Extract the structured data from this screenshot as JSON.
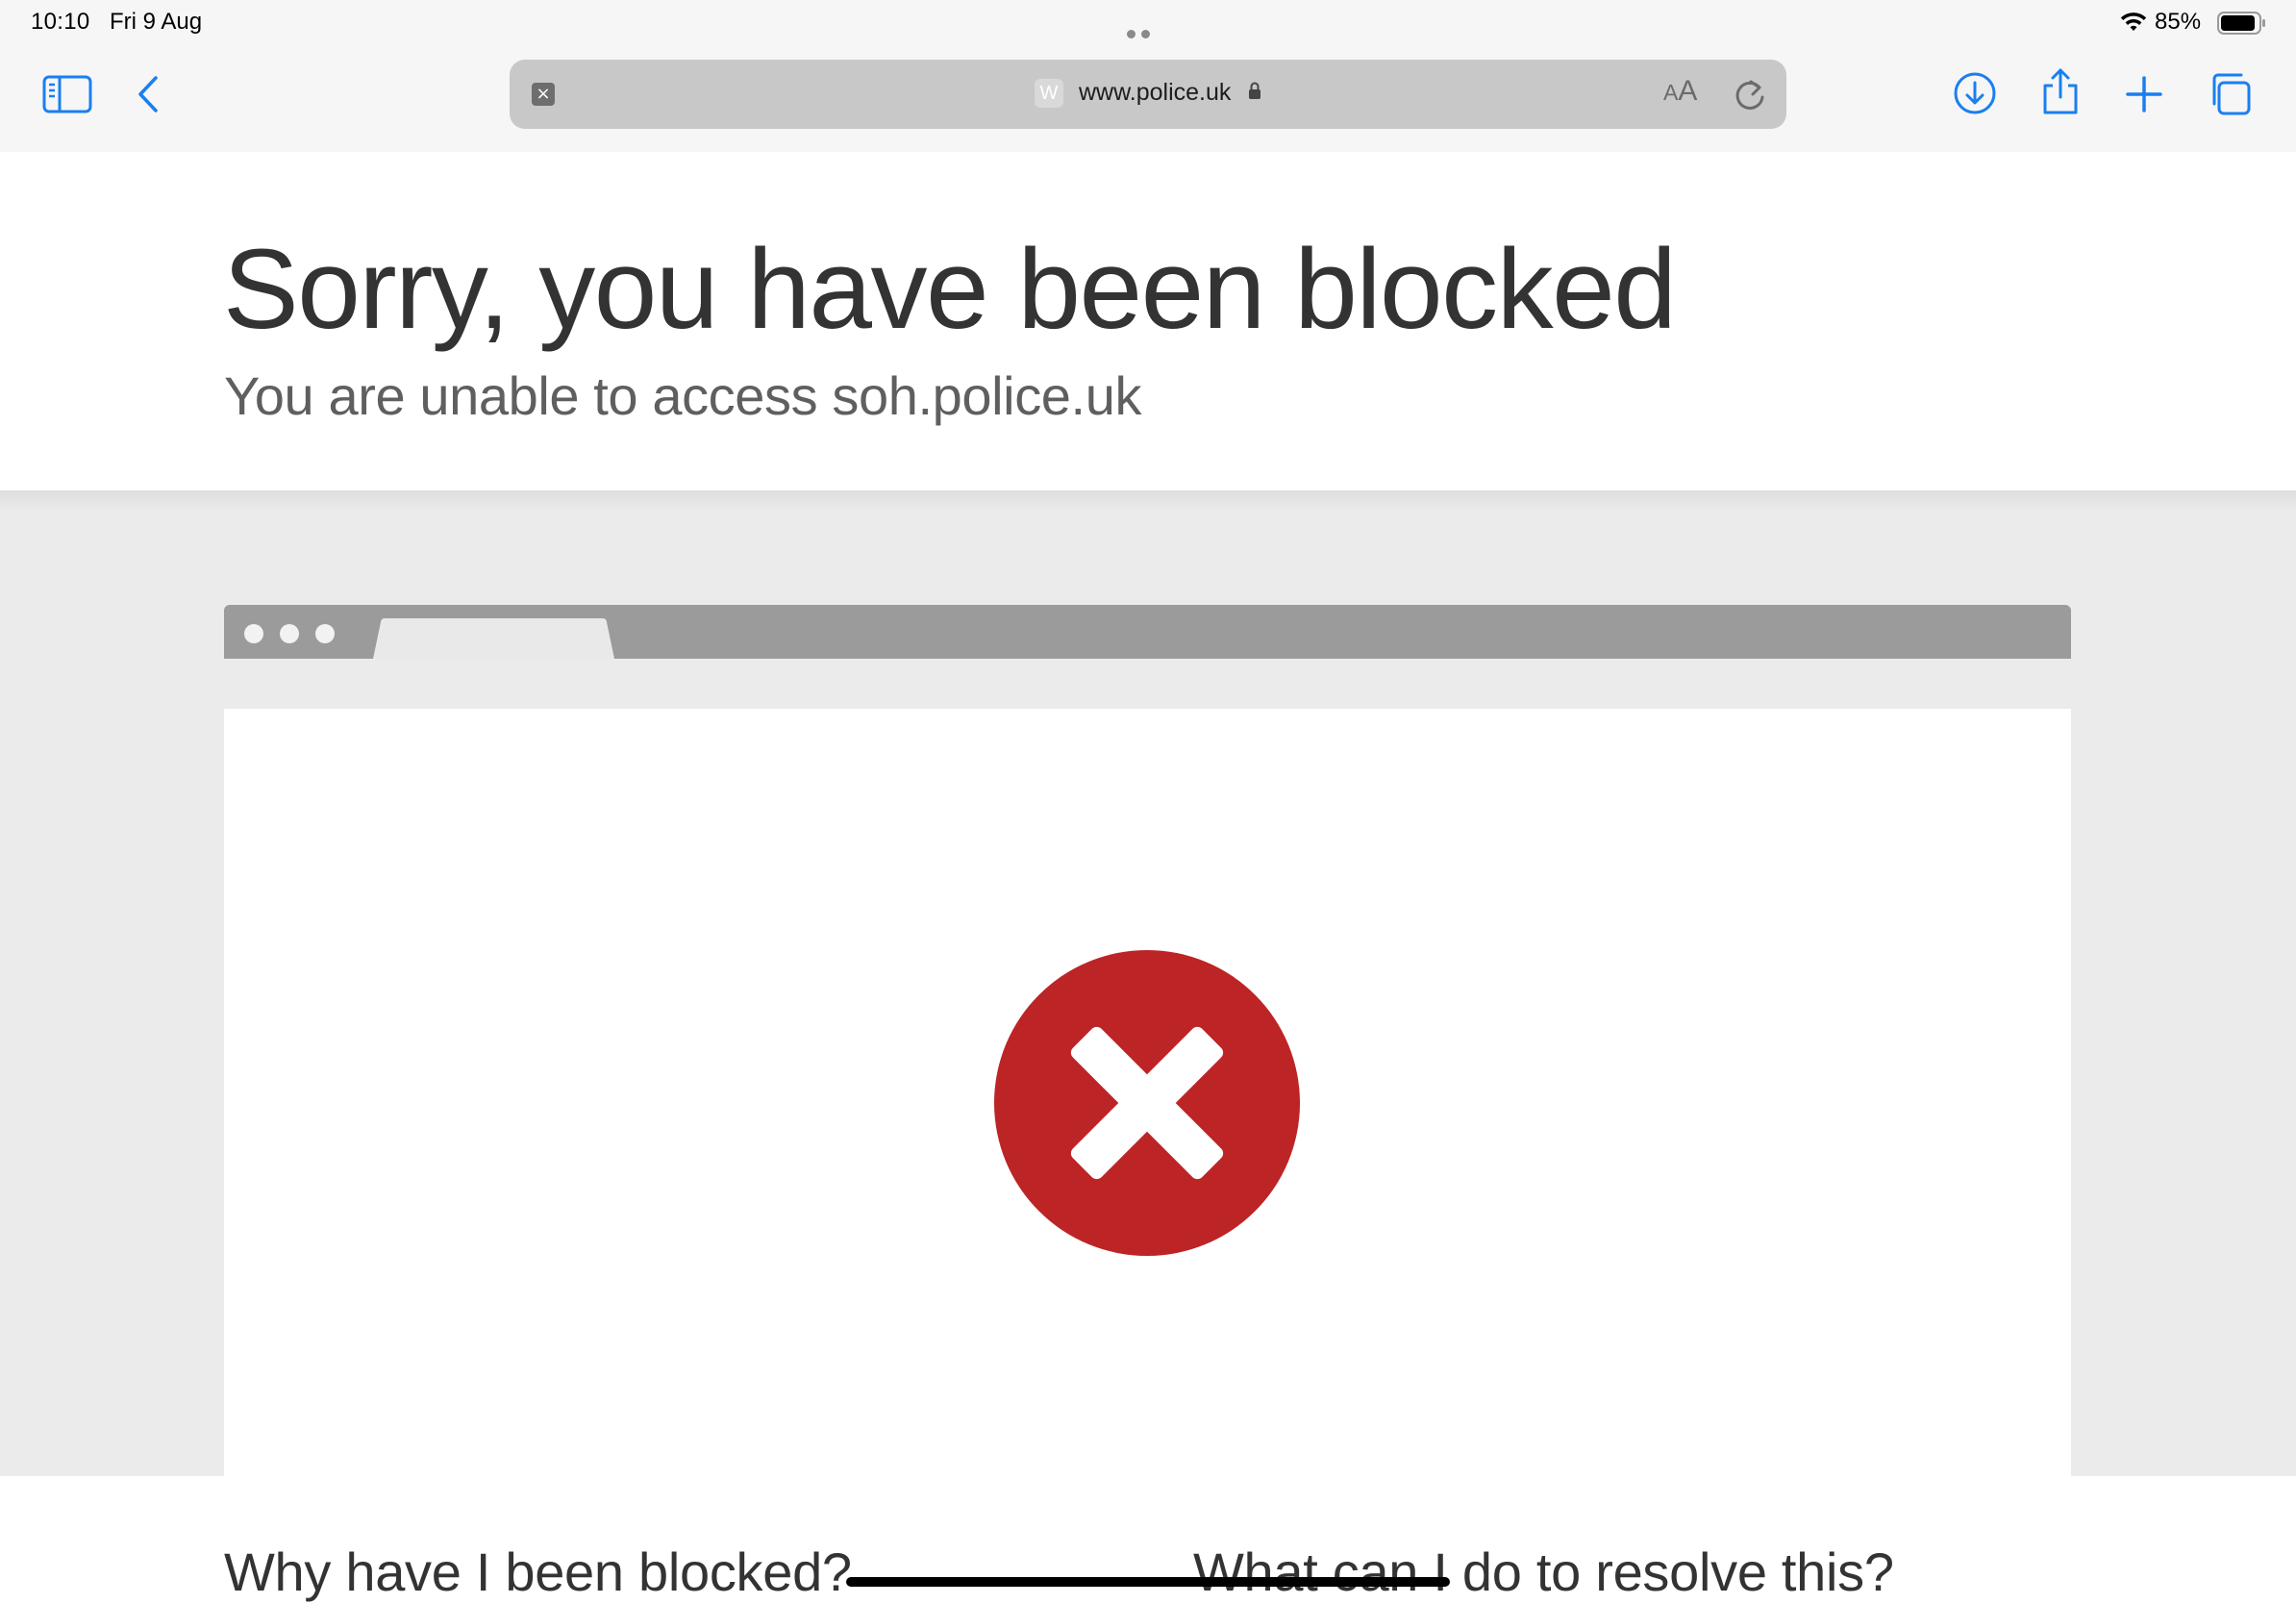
{
  "status_bar": {
    "time": "10:10",
    "date": "Fri 9 Aug",
    "battery_percent": "85%"
  },
  "browser": {
    "url": "www.police.uk",
    "favicon_letter": "W",
    "reader_label_small": "A",
    "reader_label_large": "A",
    "accent_color": "#1a7ff0"
  },
  "page": {
    "heading": "Sorry, you have been blocked",
    "subheading": "You are unable to access soh.police.uk",
    "question_1": "Why have I been blocked?",
    "question_2": "What can I do to resolve this?",
    "error_color": "#bd2426"
  }
}
